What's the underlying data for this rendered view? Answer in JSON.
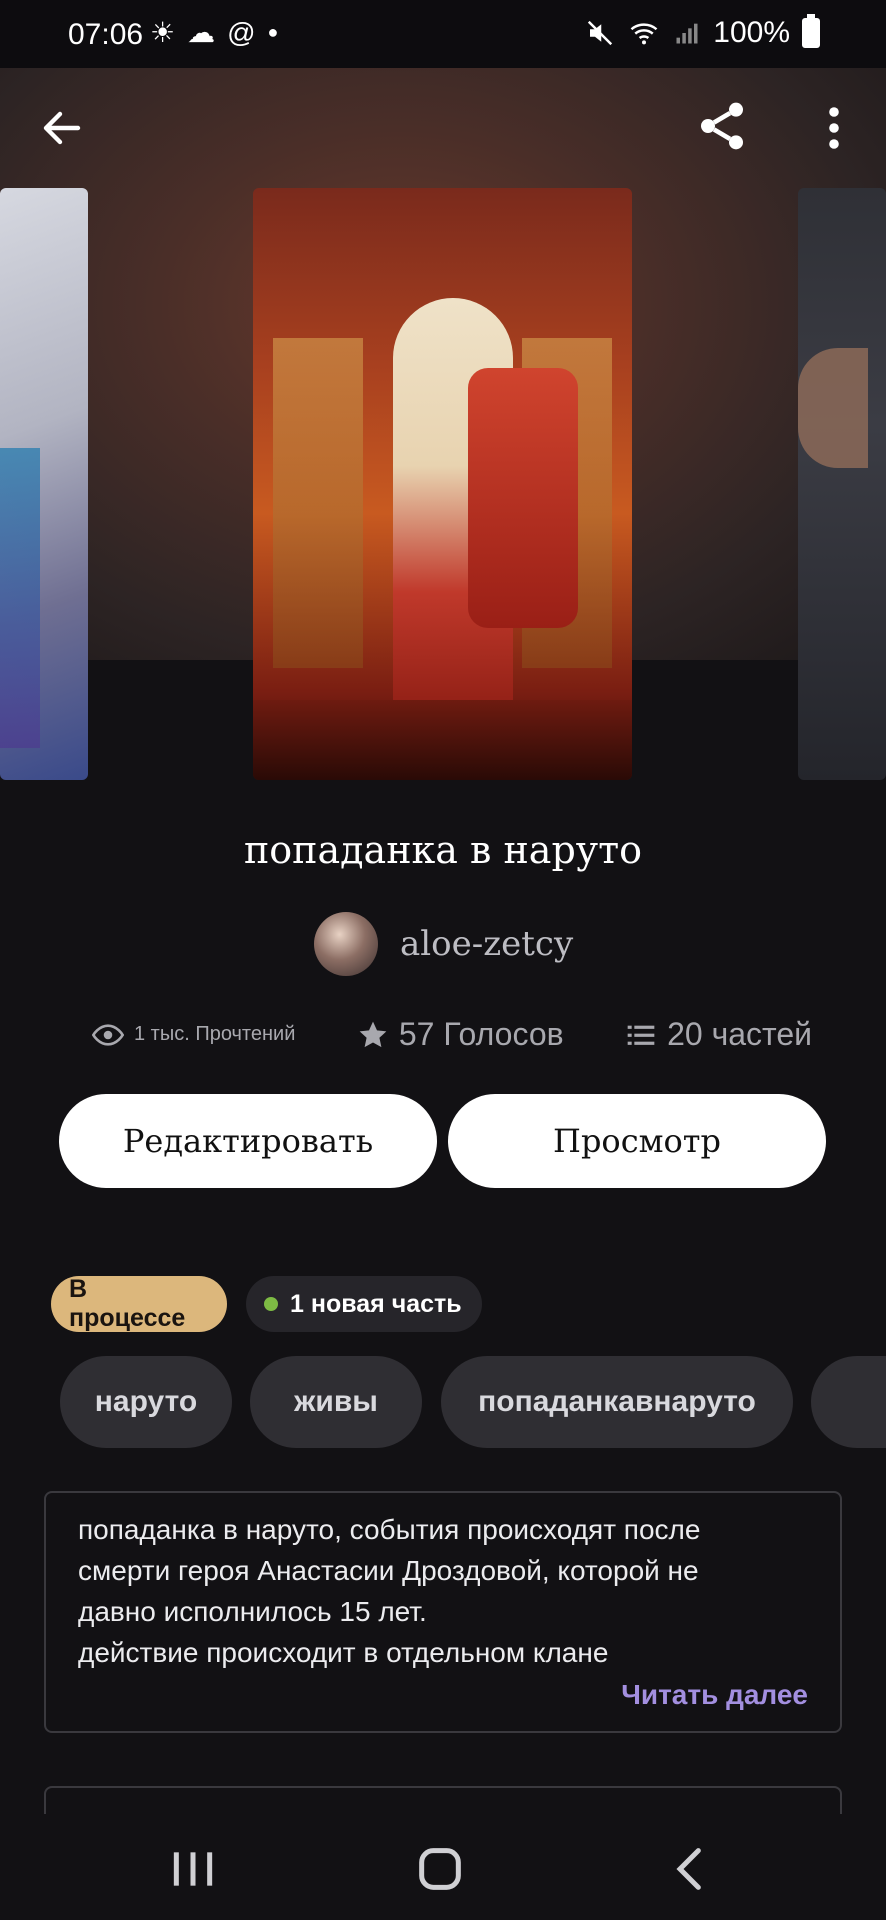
{
  "status_bar": {
    "time": "07:06",
    "left_icons": [
      "weather-sun-icon",
      "cloud-icon",
      "at-icon",
      "dot-icon"
    ],
    "battery": "100%",
    "right_icons": [
      "mute-icon",
      "wifi-icon",
      "signal-icon",
      "battery-icon"
    ]
  },
  "toolbar": {
    "back_icon": "arrow-left-icon",
    "share_icon": "share-icon",
    "more_icon": "more-vertical-icon"
  },
  "book": {
    "title": "попаданка в наруто",
    "author": "aloe-zetcy"
  },
  "stats": {
    "reads": "1 тыс. Прочтений",
    "votes": "57 Голосов",
    "parts": "20 частей"
  },
  "actions": {
    "edit": "Редактировать",
    "view": "Просмотр"
  },
  "badges": {
    "status": "В процессе",
    "new_parts": "1 новая часть"
  },
  "tags": [
    "наруто",
    "живы",
    "попаданкавнаруто",
    ""
  ],
  "description": {
    "text": "попаданка в наруто, события происходят после\nсмерти героя Анастасии Дроздовой, которой не\nдавно исполнилось 15 лет.\nдействие происходит в отдельном клане",
    "read_more": "Читать далее"
  },
  "colors": {
    "background": "#121114",
    "status_badge": "#dcb77c",
    "new_dot": "#7dbb44",
    "read_more": "#a38fe0",
    "tag_bg": "#2f2e33"
  },
  "nav": {
    "recents_icon": "recents-icon",
    "home_icon": "home-icon",
    "back_icon": "back-chevron-icon"
  }
}
